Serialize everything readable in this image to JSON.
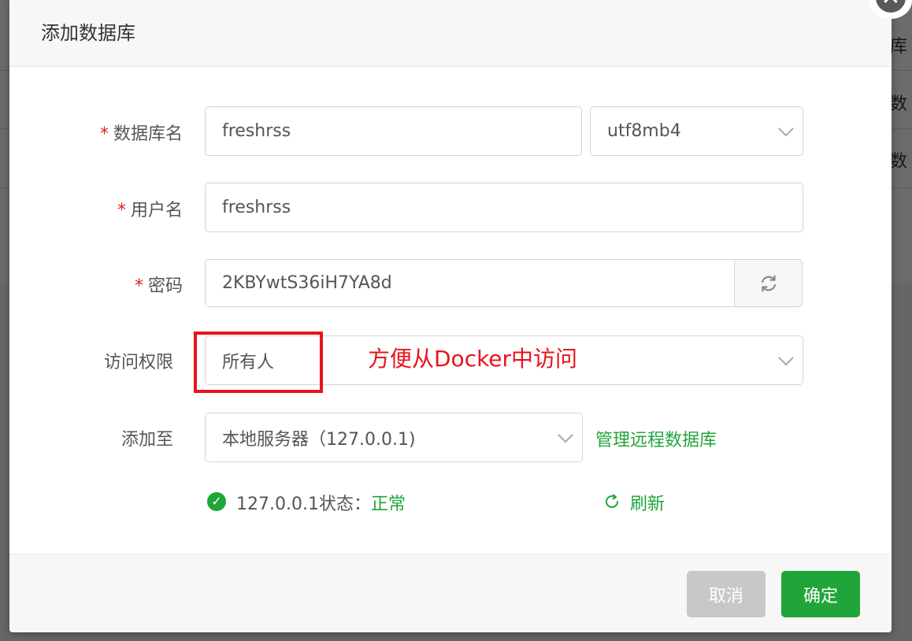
{
  "background": {
    "texts": [
      "库",
      "数",
      "数"
    ]
  },
  "dialog": {
    "title": "添加数据库",
    "close_icon": "close-icon",
    "fields": {
      "db_name": {
        "label": "数据库名",
        "required_mark": "*",
        "value": "freshrss"
      },
      "charset": {
        "value": "utf8mb4"
      },
      "username": {
        "label": "用户名",
        "required_mark": "*",
        "value": "freshrss"
      },
      "password": {
        "label": "密码",
        "required_mark": "*",
        "value": "2KBYwtS36iH7YA8d"
      },
      "access": {
        "label": "访问权限",
        "value": "所有人"
      },
      "add_to": {
        "label": "添加至",
        "value": "本地服务器（127.0.0.1)",
        "manage_link": "管理远程数据库"
      }
    },
    "annotation": "方便从Docker中访问",
    "status": {
      "prefix": "127.0.0.1状态：",
      "value": "正常",
      "refresh_label": "刷新"
    },
    "buttons": {
      "cancel": "取消",
      "confirm": "确定"
    }
  },
  "colors": {
    "accent": "#20a53a",
    "required": "#e02020",
    "annotation": "#e8131b"
  }
}
